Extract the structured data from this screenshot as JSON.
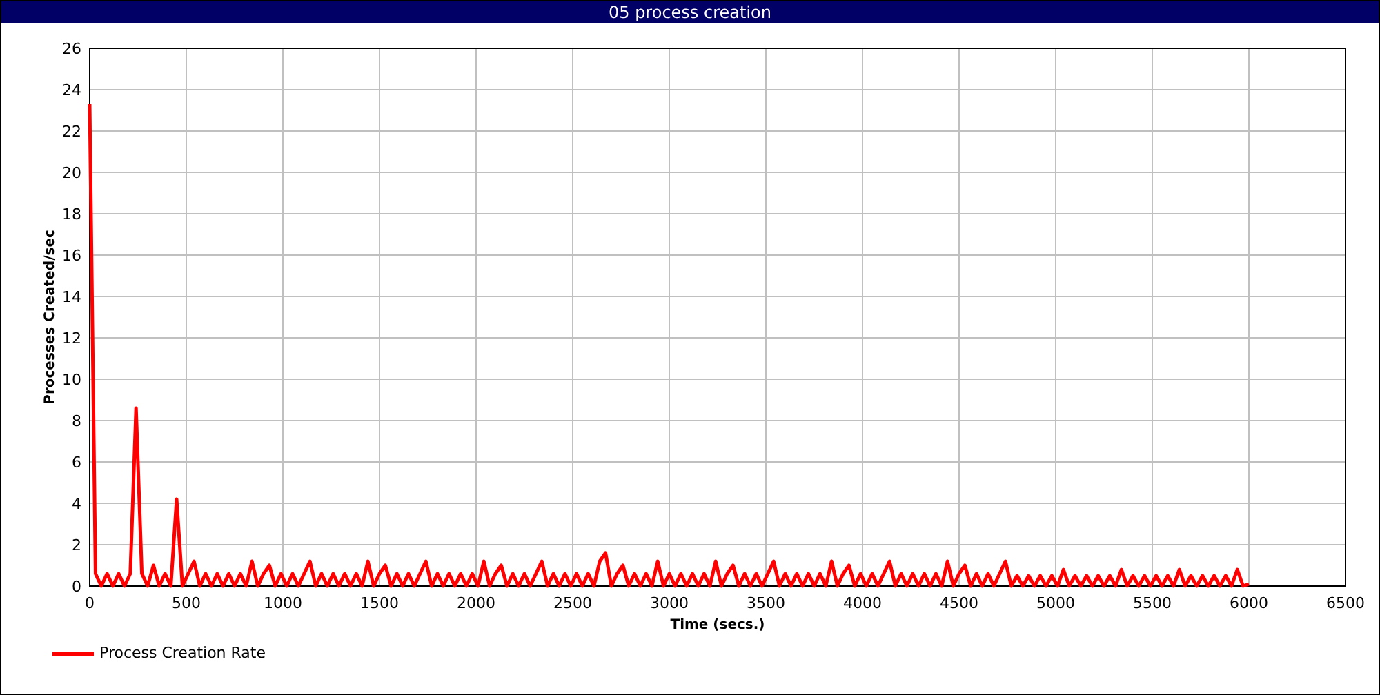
{
  "window": {
    "title": "05 process creation"
  },
  "chart_data": {
    "type": "line",
    "grid": true,
    "xlabel": "Time (secs.)",
    "ylabel": "Processes Created/sec",
    "xlim": [
      0,
      6500
    ],
    "ylim": [
      0,
      26
    ],
    "xticks": [
      0,
      500,
      1000,
      1500,
      2000,
      2500,
      3000,
      3500,
      4000,
      4500,
      5000,
      5500,
      6000,
      6500
    ],
    "yticks": [
      0,
      2,
      4,
      6,
      8,
      10,
      12,
      14,
      16,
      18,
      20,
      22,
      24,
      26
    ],
    "x": [
      0,
      30,
      60,
      90,
      120,
      150,
      180,
      210,
      240,
      270,
      300,
      330,
      360,
      390,
      420,
      450,
      480,
      510,
      540,
      570,
      600,
      630,
      660,
      690,
      720,
      750,
      780,
      810,
      840,
      870,
      900,
      930,
      960,
      990,
      1020,
      1050,
      1080,
      1110,
      1140,
      1170,
      1200,
      1230,
      1260,
      1290,
      1320,
      1350,
      1380,
      1410,
      1440,
      1470,
      1500,
      1530,
      1560,
      1590,
      1620,
      1650,
      1680,
      1710,
      1740,
      1770,
      1800,
      1830,
      1860,
      1890,
      1920,
      1950,
      1980,
      2010,
      2040,
      2070,
      2100,
      2130,
      2160,
      2190,
      2220,
      2250,
      2280,
      2310,
      2340,
      2370,
      2400,
      2430,
      2460,
      2490,
      2520,
      2550,
      2580,
      2610,
      2640,
      2670,
      2700,
      2730,
      2760,
      2790,
      2820,
      2850,
      2880,
      2910,
      2940,
      2970,
      3000,
      3030,
      3060,
      3090,
      3120,
      3150,
      3180,
      3210,
      3240,
      3270,
      3300,
      3330,
      3360,
      3390,
      3420,
      3450,
      3480,
      3510,
      3540,
      3570,
      3600,
      3630,
      3660,
      3690,
      3720,
      3750,
      3780,
      3810,
      3840,
      3870,
      3900,
      3930,
      3960,
      3990,
      4020,
      4050,
      4080,
      4110,
      4140,
      4170,
      4200,
      4230,
      4260,
      4290,
      4320,
      4350,
      4380,
      4410,
      4440,
      4470,
      4500,
      4530,
      4560,
      4590,
      4620,
      4650,
      4680,
      4710,
      4740,
      4770,
      4800,
      4830,
      4860,
      4890,
      4920,
      4950,
      4980,
      5010,
      5040,
      5070,
      5100,
      5130,
      5160,
      5190,
      5220,
      5250,
      5280,
      5310,
      5340,
      5370,
      5400,
      5430,
      5460,
      5490,
      5520,
      5550,
      5580,
      5610,
      5640,
      5670,
      5700,
      5730,
      5760,
      5790,
      5820,
      5850,
      5880,
      5910,
      5940,
      5970,
      6000
    ],
    "series": [
      {
        "name": "Process Creation Rate",
        "color": "#ff0000",
        "values": [
          23.3,
          0.6,
          0,
          0.6,
          0,
          0.6,
          0,
          0.6,
          8.6,
          0.6,
          0,
          1.0,
          0,
          0.6,
          0,
          4.2,
          0,
          0.6,
          1.2,
          0,
          0.6,
          0,
          0.6,
          0,
          0.6,
          0,
          0.6,
          0,
          1.2,
          0,
          0.6,
          1.0,
          0,
          0.6,
          0,
          0.6,
          0,
          0.6,
          1.2,
          0,
          0.6,
          0,
          0.6,
          0,
          0.6,
          0,
          0.6,
          0,
          1.2,
          0,
          0.6,
          1.0,
          0,
          0.6,
          0,
          0.6,
          0,
          0.6,
          1.2,
          0,
          0.6,
          0,
          0.6,
          0,
          0.6,
          0,
          0.6,
          0,
          1.2,
          0,
          0.6,
          1.0,
          0,
          0.6,
          0,
          0.6,
          0,
          0.6,
          1.2,
          0,
          0.6,
          0,
          0.6,
          0,
          0.6,
          0,
          0.6,
          0,
          1.2,
          1.6,
          0,
          0.6,
          1.0,
          0,
          0.6,
          0,
          0.6,
          0,
          1.2,
          0,
          0.6,
          0,
          0.6,
          0,
          0.6,
          0,
          0.6,
          0,
          1.2,
          0,
          0.6,
          1.0,
          0,
          0.6,
          0,
          0.6,
          0,
          0.6,
          1.2,
          0,
          0.6,
          0,
          0.6,
          0,
          0.6,
          0,
          0.6,
          0,
          1.2,
          0,
          0.6,
          1.0,
          0,
          0.6,
          0,
          0.6,
          0,
          0.6,
          1.2,
          0,
          0.6,
          0,
          0.6,
          0,
          0.6,
          0,
          0.6,
          0,
          1.2,
          0,
          0.6,
          1.0,
          0,
          0.6,
          0,
          0.6,
          0,
          0.6,
          1.2,
          0,
          0.5,
          0,
          0.5,
          0,
          0.5,
          0,
          0.5,
          0,
          0.8,
          0,
          0.5,
          0,
          0.5,
          0,
          0.5,
          0,
          0.5,
          0,
          0.8,
          0,
          0.5,
          0,
          0.5,
          0,
          0.5,
          0,
          0.5,
          0,
          0.8,
          0,
          0.5,
          0,
          0.5,
          0,
          0.5,
          0,
          0.5,
          0,
          0.8,
          0,
          0.1
        ]
      }
    ]
  }
}
